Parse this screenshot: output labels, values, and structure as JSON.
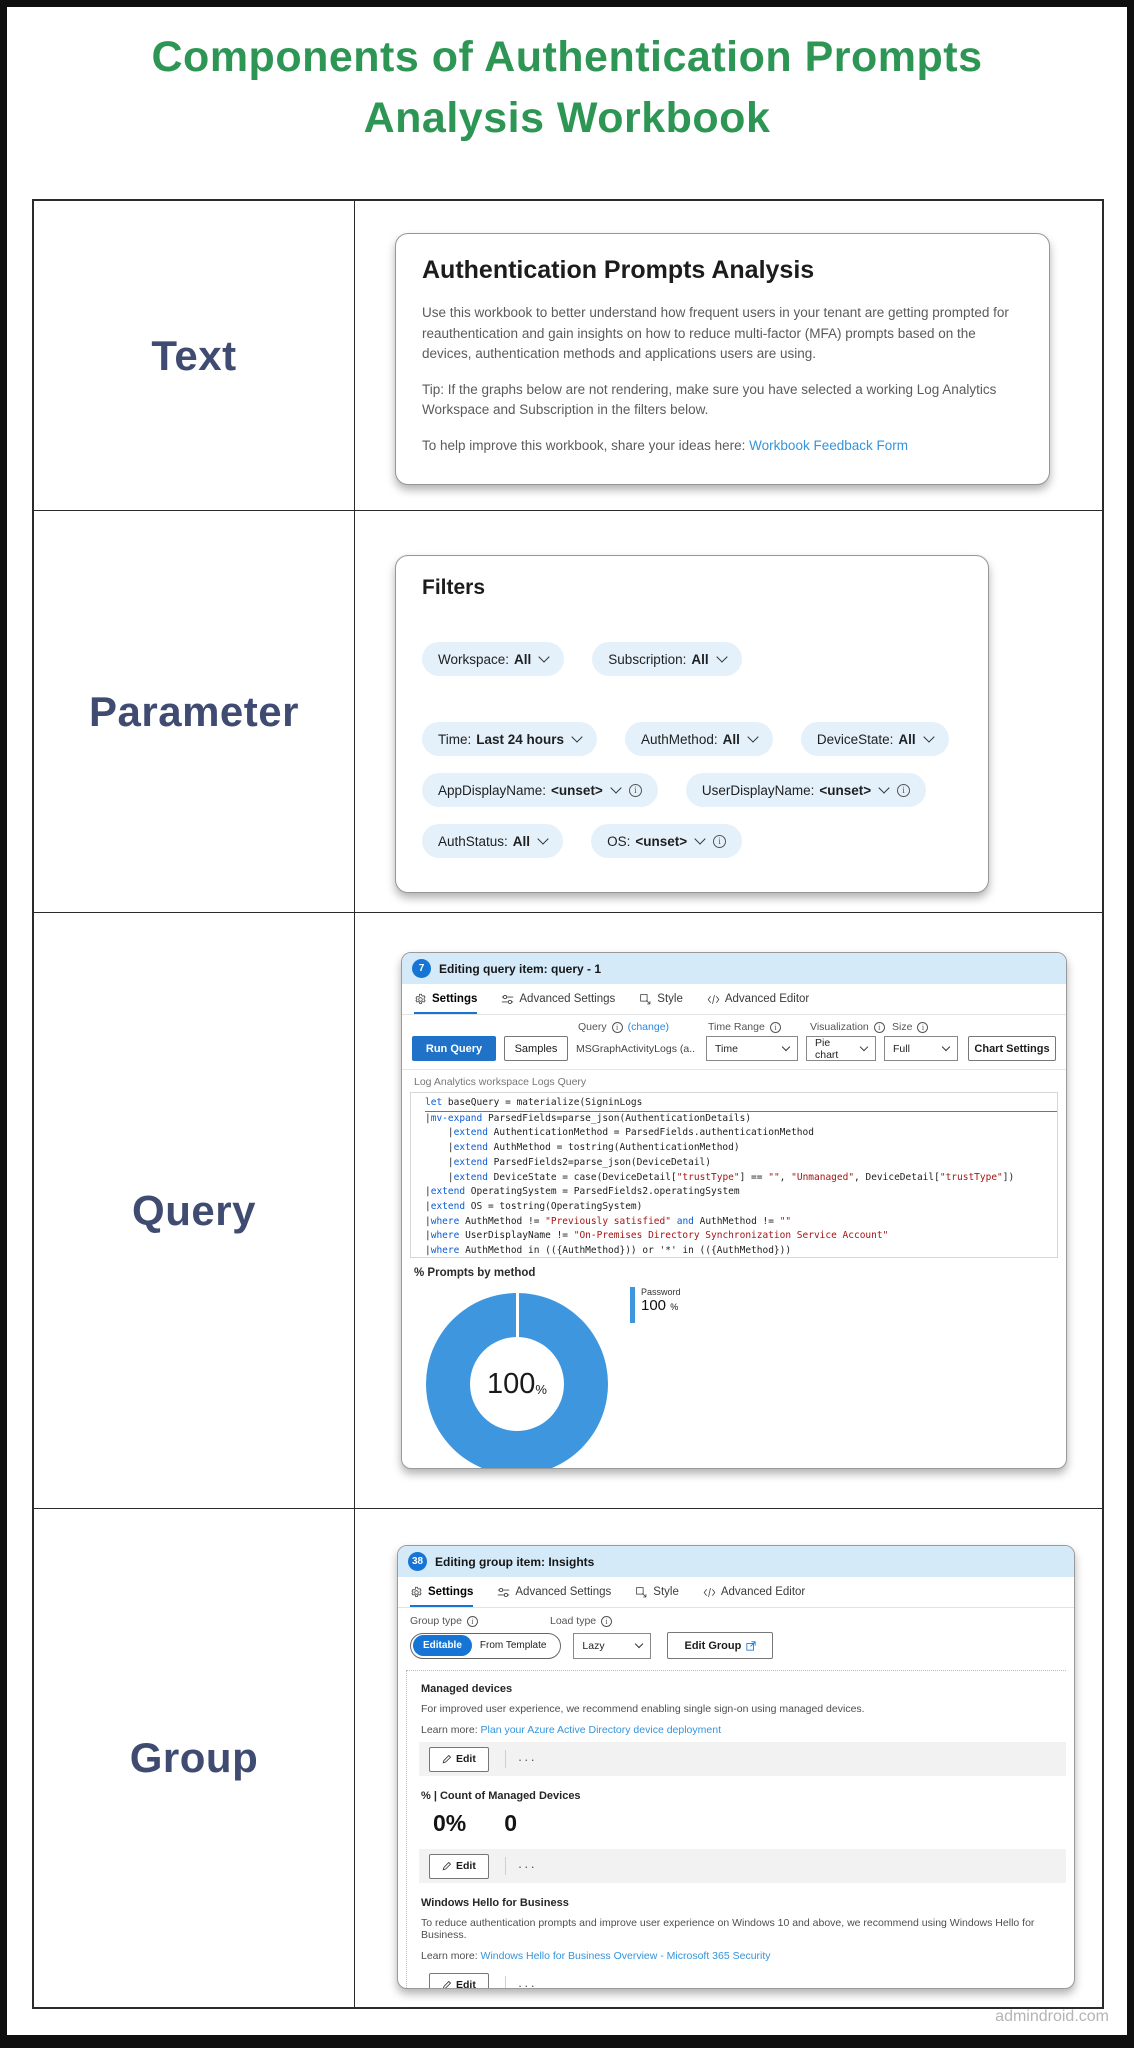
{
  "page": {
    "title_line1": "Components of Authentication Prompts",
    "title_line2": "Analysis Workbook",
    "watermark": "admindroid.com",
    "accent_green": "#2e9655",
    "label_navy": "#3f4b70"
  },
  "row_labels": [
    "Text",
    "Parameter",
    "Query",
    "Group"
  ],
  "text_card": {
    "title": "Authentication Prompts Analysis",
    "para1": "Use this workbook to better understand how frequent users in your tenant are getting prompted for reauthentication and gain insights on how to reduce multi-factor (MFA) prompts based on the devices, authentication methods and applications users are using.",
    "para2": "Tip: If the graphs below are not rendering, make sure you have selected a working Log Analytics Workspace and Subscription in the filters below.",
    "para3_prefix": "To help improve this workbook, share your ideas here: ",
    "para3_link": "Workbook Feedback Form"
  },
  "filters_card": {
    "title": "Filters",
    "pills": [
      {
        "label": "Workspace:",
        "value": "All"
      },
      {
        "label": "Subscription:",
        "value": "All"
      },
      {
        "label": "Time:",
        "value": "Last 24 hours"
      },
      {
        "label": "AuthMethod:",
        "value": "All"
      },
      {
        "label": "DeviceState:",
        "value": "All"
      },
      {
        "label": "AppDisplayName:",
        "value": "<unset>"
      },
      {
        "label": "UserDisplayName:",
        "value": "<unset>"
      },
      {
        "label": "AuthStatus:",
        "value": "All"
      },
      {
        "label": "OS:",
        "value": "<unset>"
      }
    ]
  },
  "tabs": [
    "Settings",
    "Advanced Settings",
    "Style",
    "Advanced Editor"
  ],
  "query_card": {
    "badge": "7",
    "header": "Editing query item: query - 1",
    "toolbar": {
      "query_label": "Query",
      "change_link": "(change)",
      "time_range_label": "Time Range",
      "visualization_label": "Visualization",
      "size_label": "Size",
      "run_query": "Run Query",
      "samples": "Samples",
      "query_value": "MSGraphActivityLogs (a...",
      "time_range_value": "Time",
      "visualization_value": "Pie chart",
      "size_value": "Full",
      "chart_settings": "Chart Settings"
    },
    "source_label": "Log Analytics workspace Logs Query",
    "code_lines": [
      [
        {
          "t": "let ",
          "c": "kw"
        },
        {
          "t": "baseQuery = materialize(SigninLogs"
        }
      ],
      [
        {
          "t": "|"
        },
        {
          "t": "mv-expand",
          "c": "kw"
        },
        {
          "t": " ParsedFields=parse_json(AuthenticationDetails)"
        }
      ],
      [
        {
          "t": "    |"
        },
        {
          "t": "extend",
          "c": "kw"
        },
        {
          "t": " AuthenticationMethod = ParsedFields.authenticationMethod"
        }
      ],
      [
        {
          "t": "    |"
        },
        {
          "t": "extend",
          "c": "kw"
        },
        {
          "t": " AuthMethod = tostring(AuthenticationMethod)"
        }
      ],
      [
        {
          "t": "    |"
        },
        {
          "t": "extend",
          "c": "kw"
        },
        {
          "t": " ParsedFields2=parse_json(DeviceDetail)"
        }
      ],
      [
        {
          "t": "    |"
        },
        {
          "t": "extend",
          "c": "kw"
        },
        {
          "t": " DeviceState = case(DeviceDetail["
        },
        {
          "t": "\"trustType\"",
          "c": "str"
        },
        {
          "t": "] == "
        },
        {
          "t": "\"\"",
          "c": "str"
        },
        {
          "t": ", "
        },
        {
          "t": "\"Unmanaged\"",
          "c": "str"
        },
        {
          "t": ", DeviceDetail["
        },
        {
          "t": "\"trustType\"",
          "c": "str"
        },
        {
          "t": "])"
        }
      ],
      [
        {
          "t": "|"
        },
        {
          "t": "extend",
          "c": "kw"
        },
        {
          "t": " OperatingSystem = ParsedFields2.operatingSystem"
        }
      ],
      [
        {
          "t": "|"
        },
        {
          "t": "extend",
          "c": "kw"
        },
        {
          "t": " OS = tostring(OperatingSystem)"
        }
      ],
      [
        {
          "t": "|"
        },
        {
          "t": "where",
          "c": "kw"
        },
        {
          "t": " AuthMethod != "
        },
        {
          "t": "\"Previously satisfied\"",
          "c": "str"
        },
        {
          "t": " "
        },
        {
          "t": "and",
          "c": "kw"
        },
        {
          "t": " AuthMethod != "
        },
        {
          "t": "\"\"",
          "c": "str"
        }
      ],
      [
        {
          "t": "|"
        },
        {
          "t": "where",
          "c": "kw"
        },
        {
          "t": " UserDisplayName != "
        },
        {
          "t": "\"On-Premises Directory Synchronization Service Account\"",
          "c": "str"
        }
      ],
      [
        {
          "t": "|"
        },
        {
          "t": "where",
          "c": "kw"
        },
        {
          "t": " AuthMethod in (({AuthMethod})) or '*' in (({AuthMethod}))"
        }
      ]
    ],
    "chart_title": "% Prompts by method",
    "legend": {
      "name": "Password",
      "value": "100",
      "unit": "%"
    },
    "donut": {
      "center_value": "100",
      "center_unit": "%",
      "color": "#3e97de",
      "series": "Password",
      "percent": 100
    }
  },
  "group_card": {
    "badge": "38",
    "header": "Editing group item: Insights",
    "group_type_label": "Group type",
    "load_type_label": "Load type",
    "toggle_selected": "Editable",
    "toggle_other": "From Template",
    "load_type_value": "Lazy",
    "edit_group": "Edit Group",
    "edit_label": "Edit",
    "more_label": "···",
    "sections": [
      {
        "heading": "Managed devices",
        "body": "For improved user experience, we recommend enabling single sign-on using managed devices.",
        "learn_prefix": "Learn more: ",
        "link": "Plan your Azure Active Directory device deployment"
      },
      {
        "heading": "% | Count of Managed Devices",
        "values": [
          "0%",
          "0"
        ]
      },
      {
        "heading": "Windows Hello for Business",
        "body": "To reduce authentication prompts and improve user experience on Windows 10 and above, we recommend using Windows Hello for Business.",
        "learn_prefix": "Learn more: ",
        "link": "Windows Hello for Business Overview - Microsoft 365 Security"
      }
    ]
  }
}
